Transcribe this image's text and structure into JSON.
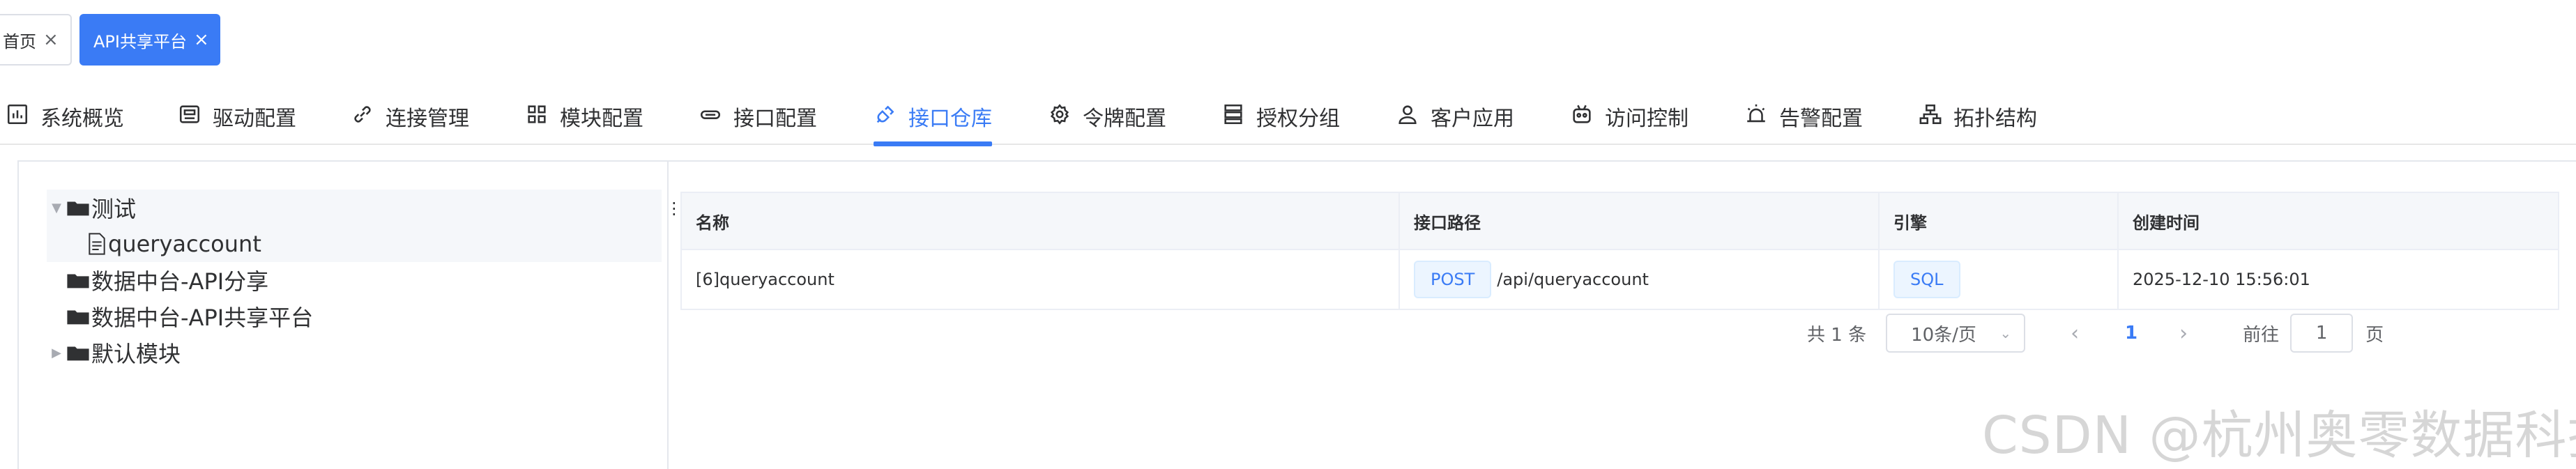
{
  "tags": {
    "home_label": "首页",
    "active_label": "API共享平台"
  },
  "menu": {
    "items": [
      {
        "label": "系统概览",
        "icon": "bar-chart-icon"
      },
      {
        "label": "驱动配置",
        "icon": "driver-icon"
      },
      {
        "label": "连接管理",
        "icon": "link-icon"
      },
      {
        "label": "模块配置",
        "icon": "grid-icon"
      },
      {
        "label": "接口配置",
        "icon": "interface-icon"
      },
      {
        "label": "接口仓库",
        "icon": "plug-icon"
      },
      {
        "label": "令牌配置",
        "icon": "gear-icon"
      },
      {
        "label": "授权分组",
        "icon": "layers-icon"
      },
      {
        "label": "客户应用",
        "icon": "user-icon"
      },
      {
        "label": "访问控制",
        "icon": "robot-icon"
      },
      {
        "label": "告警配置",
        "icon": "alarm-icon"
      },
      {
        "label": "拓扑结构",
        "icon": "topology-icon"
      }
    ],
    "active_index": 5
  },
  "tree": {
    "nodes": [
      {
        "label": "测试",
        "type": "folder",
        "expanded": true
      },
      {
        "label": "queryaccount",
        "type": "document"
      },
      {
        "label": "数据中台-API分享",
        "type": "folder"
      },
      {
        "label": "数据中台-API共享平台",
        "type": "folder"
      },
      {
        "label": "默认模块",
        "type": "folder",
        "expanded": false
      }
    ]
  },
  "table": {
    "headers": [
      "名称",
      "接口路径",
      "引擎",
      "创建时间"
    ],
    "rows": [
      {
        "name": "[6]queryaccount",
        "method": "POST",
        "path": "/api/queryaccount",
        "engine": "SQL",
        "created": "2025-12-10 15:56:01"
      }
    ]
  },
  "pagination": {
    "total": "共 1 条",
    "page_size": "10条/页",
    "current_page": "1",
    "goto_label": "前往",
    "goto_value": "1",
    "page_suffix": "页"
  },
  "watermark": "CSDN @杭州奥零数据科技",
  "colors": {
    "accent": "#3a7bf5",
    "tag_bg": "#ecf5ff"
  }
}
